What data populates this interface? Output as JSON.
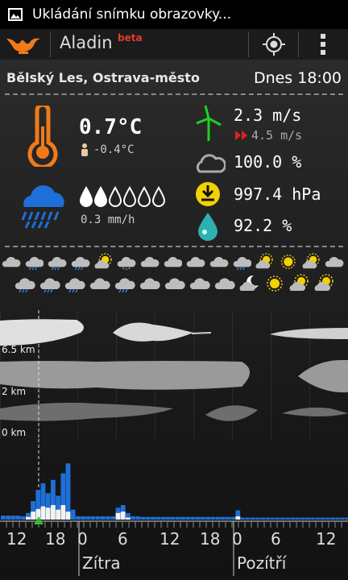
{
  "status_bar": {
    "notification": "Ukládání snímku obrazovky..."
  },
  "action_bar": {
    "app_title": "Aladin",
    "beta_badge": "beta"
  },
  "location": {
    "name": "Bělský Les, Ostrava-město",
    "time": "Dnes 18:00"
  },
  "current": {
    "temperature": "0.7°C",
    "feels_like": "-0.4°C",
    "precip_drops_filled": 2,
    "precip_drops_total": 6,
    "precip_rate": "0.3 mm/h",
    "wind_speed": "2.3 m/s",
    "wind_gust": "4.5 m/s",
    "cloudiness": "100.0 %",
    "pressure": "997.4 hPa",
    "humidity": "92.2 %"
  },
  "forecast_icons": {
    "row1": [
      "cloud",
      "cloud-rain",
      "cloud-rain",
      "cloud-rain",
      "sun-cloud",
      "cloud-drizzle",
      "cloud",
      "cloud",
      "cloud",
      "cloud",
      "cloud-rain",
      "sun-cloud",
      "sun",
      "sun-cloud",
      "cloud"
    ],
    "row2": [
      "cloud-rain",
      "cloud-rain",
      "cloud-rain",
      "cloud",
      "cloud-rain",
      "cloud",
      "cloud",
      "cloud",
      "cloud",
      "moon-cloud",
      "sun",
      "sun-cloud",
      "sun-cloud"
    ]
  },
  "cloud_layers": {
    "labels": [
      "6.5 km",
      "2 km",
      "0 km"
    ]
  },
  "precip_chart": {
    "blue": [
      0.06,
      0.06,
      0.06,
      0.06,
      0.05,
      0.1,
      0.28,
      0.45,
      0.55,
      0.4,
      0.6,
      0.36,
      0.7,
      0.85,
      0.15,
      0.05,
      0.05,
      0.05,
      0.05,
      0.05,
      0.05,
      0.05,
      0.05,
      0.18,
      0.22,
      0.1,
      0.05,
      0.05,
      0.04,
      0.04,
      0.04,
      0.04,
      0.04,
      0.04,
      0.04,
      0.04,
      0.04,
      0.04,
      0.04,
      0.04,
      0.04,
      0.04,
      0.04,
      0.04,
      0.04,
      0.04,
      0.04,
      0.14,
      0.03,
      0.03,
      0.03,
      0.03,
      0.03,
      0.03,
      0.03,
      0.03,
      0.03,
      0.03,
      0.03,
      0.03,
      0.03,
      0.03,
      0.03,
      0.03,
      0.03,
      0.03,
      0.03,
      0.03,
      0.03,
      0.03
    ],
    "white": [
      0,
      0,
      0,
      0,
      0,
      0.04,
      0.12,
      0.16,
      0.2,
      0.18,
      0.22,
      0.15,
      0.22,
      0.12,
      0,
      0,
      0,
      0,
      0,
      0,
      0,
      0,
      0,
      0.1,
      0.12,
      0.03,
      0,
      0,
      0,
      0,
      0,
      0,
      0,
      0,
      0,
      0,
      0,
      0,
      0,
      0,
      0,
      0,
      0,
      0,
      0,
      0,
      0,
      0.05,
      0,
      0,
      0,
      0,
      0,
      0,
      0,
      0,
      0,
      0,
      0,
      0,
      0,
      0,
      0,
      0,
      0,
      0,
      0,
      0,
      0,
      0
    ]
  },
  "timeline": {
    "hours": [
      "12",
      "18",
      "0",
      "6",
      "12",
      "18",
      "0",
      "6",
      "12"
    ],
    "days": [
      "Zítra",
      "Pozítří"
    ],
    "current_marker": "now"
  }
}
